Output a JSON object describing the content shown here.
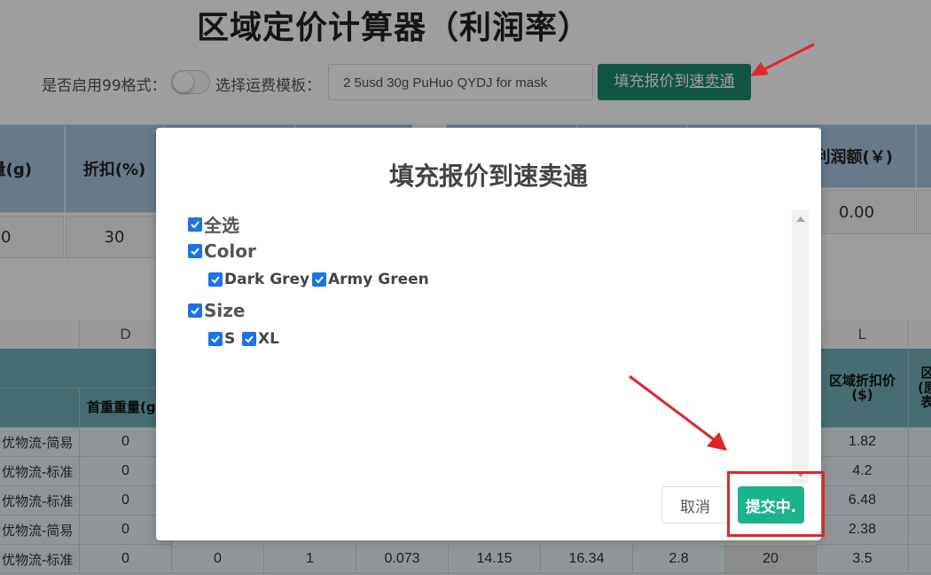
{
  "page": {
    "title": "区域定价计算器（利润率）",
    "toggle_label": "是否启用99格式：",
    "template_label": "选择运费模板：",
    "template_value": "2 5usd 30g PuHuo QYDJ for mask",
    "fill_button": {
      "prefix": "填充报价到",
      "underlined": "速卖通"
    }
  },
  "summary_table": {
    "headers": [
      "量(g)",
      "折扣(%)",
      "利润额(￥)"
    ],
    "values": [
      "0",
      "30",
      "0.00"
    ]
  },
  "grid": {
    "column_letters": [
      "D",
      "L"
    ],
    "headers": {
      "first_weight": "首重重量(g",
      "regional_discount": "区域折扣价\n($)",
      "clipped": "区\n(原\n表"
    },
    "rows": [
      {
        "name": "优物流-简易",
        "d": "0",
        "l": "1.82"
      },
      {
        "name": "优物流-标准",
        "d": "0",
        "l": "4.2"
      },
      {
        "name": "优物流-标准",
        "d": "0",
        "l": "6.48"
      },
      {
        "name": "优物流-简易",
        "d": "0",
        "l": "2.38"
      },
      {
        "name": "优物流-标准",
        "d": "0",
        "e": "0",
        "f": "1",
        "g": "0.073",
        "h": "14.15",
        "i": "16.34",
        "j": "2.8",
        "k": "20",
        "l": "3.5"
      }
    ]
  },
  "modal": {
    "title": "填充报价到速卖通",
    "select_all": "全选",
    "groups": [
      {
        "label": "Color",
        "options": [
          "Dark Grey",
          "Army Green"
        ]
      },
      {
        "label": "Size",
        "options": [
          "S",
          "XL"
        ]
      }
    ],
    "cancel_label": "取消",
    "submit_label": "提交中."
  },
  "colors": {
    "primary_green": "#1c8c6c",
    "submit_green": "#1bb38c",
    "checkbox_blue": "#1a73e8",
    "annotation_red": "#e0262a",
    "table_header_blue": "#a8c4de",
    "table_header_teal": "#73afb7"
  }
}
